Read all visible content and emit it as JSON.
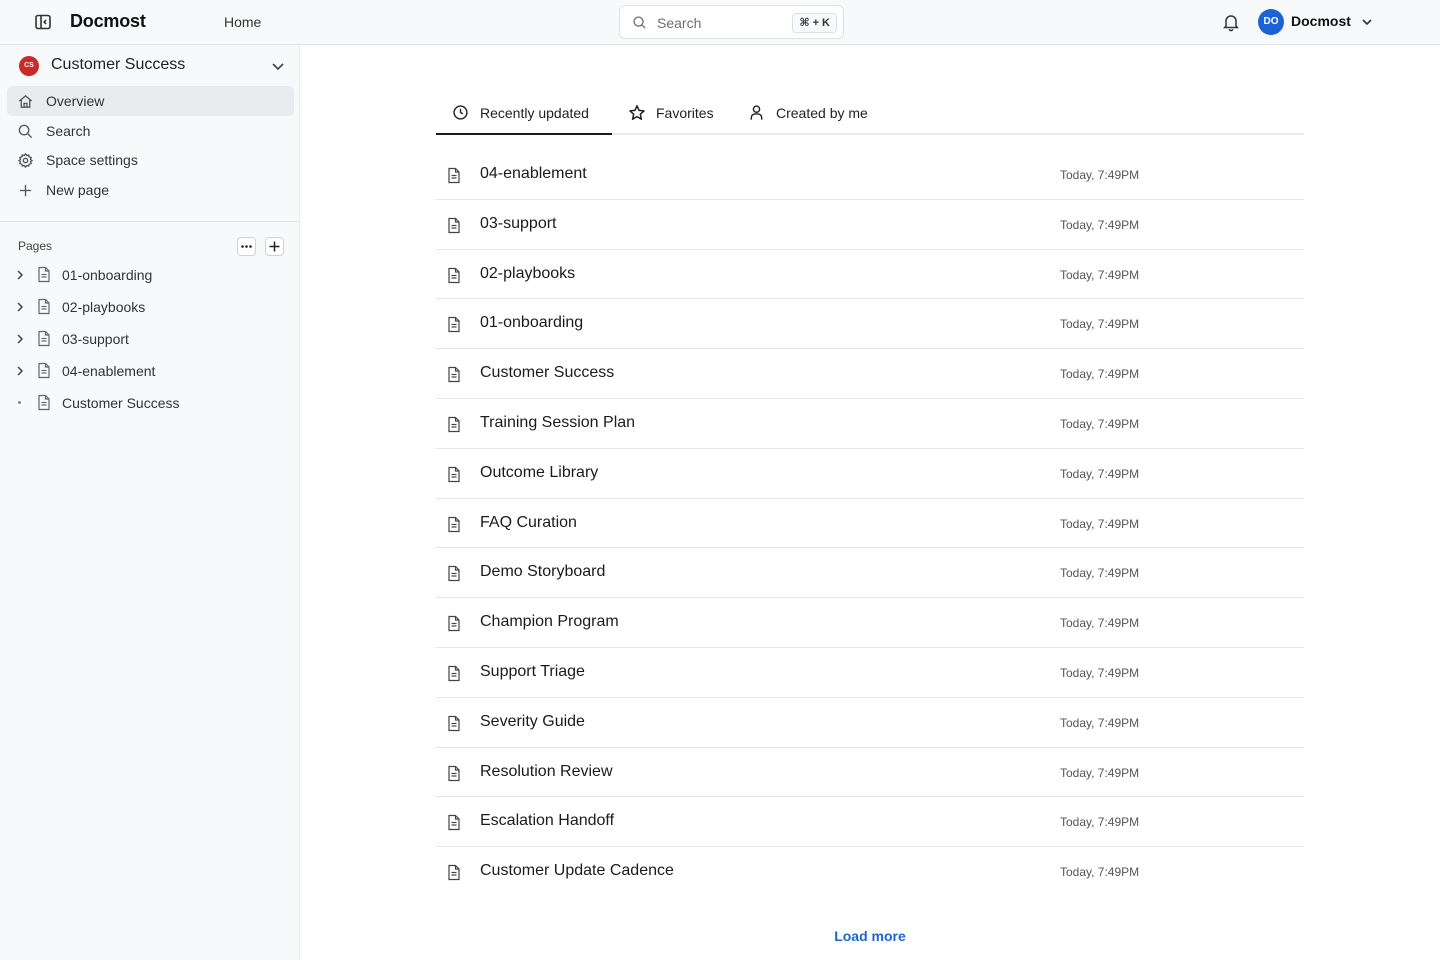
{
  "header": {
    "brand": "Docmost",
    "home_label": "Home",
    "search": {
      "placeholder": "Search",
      "shortcut": "⌘ + K"
    },
    "user": {
      "initials": "DO",
      "name": "Docmost",
      "avatar_color": "#1c64d6"
    }
  },
  "sidebar": {
    "space": {
      "initials": "CS",
      "name": "Customer Success",
      "color": "#c92a2a"
    },
    "nav": [
      {
        "label": "Overview",
        "icon": "home-icon",
        "active": true
      },
      {
        "label": "Search",
        "icon": "search-icon"
      },
      {
        "label": "Space settings",
        "icon": "gear-icon"
      },
      {
        "label": "New page",
        "icon": "plus-icon"
      }
    ],
    "pages_label": "Pages",
    "tree": [
      {
        "label": "01-onboarding",
        "expandable": true
      },
      {
        "label": "02-playbooks",
        "expandable": true
      },
      {
        "label": "03-support",
        "expandable": true
      },
      {
        "label": "04-enablement",
        "expandable": true
      },
      {
        "label": "Customer Success",
        "expandable": false
      }
    ]
  },
  "main": {
    "tabs": [
      {
        "label": "Recently updated",
        "icon": "clock-icon",
        "active": true
      },
      {
        "label": "Favorites",
        "icon": "star-icon"
      },
      {
        "label": "Created by me",
        "icon": "user-icon"
      }
    ],
    "pages": [
      {
        "title": "04-enablement",
        "updated": "Today, 7:49PM"
      },
      {
        "title": "03-support",
        "updated": "Today, 7:49PM"
      },
      {
        "title": "02-playbooks",
        "updated": "Today, 7:49PM"
      },
      {
        "title": "01-onboarding",
        "updated": "Today, 7:49PM"
      },
      {
        "title": "Customer Success",
        "updated": "Today, 7:49PM"
      },
      {
        "title": "Training Session Plan",
        "updated": "Today, 7:49PM"
      },
      {
        "title": "Outcome Library",
        "updated": "Today, 7:49PM"
      },
      {
        "title": "FAQ Curation",
        "updated": "Today, 7:49PM"
      },
      {
        "title": "Demo Storyboard",
        "updated": "Today, 7:49PM"
      },
      {
        "title": "Champion Program",
        "updated": "Today, 7:49PM"
      },
      {
        "title": "Support Triage",
        "updated": "Today, 7:49PM"
      },
      {
        "title": "Severity Guide",
        "updated": "Today, 7:49PM"
      },
      {
        "title": "Resolution Review",
        "updated": "Today, 7:49PM"
      },
      {
        "title": "Escalation Handoff",
        "updated": "Today, 7:49PM"
      },
      {
        "title": "Customer Update Cadence",
        "updated": "Today, 7:49PM"
      }
    ],
    "load_more": "Load more",
    "accent": "#1c64d6"
  }
}
